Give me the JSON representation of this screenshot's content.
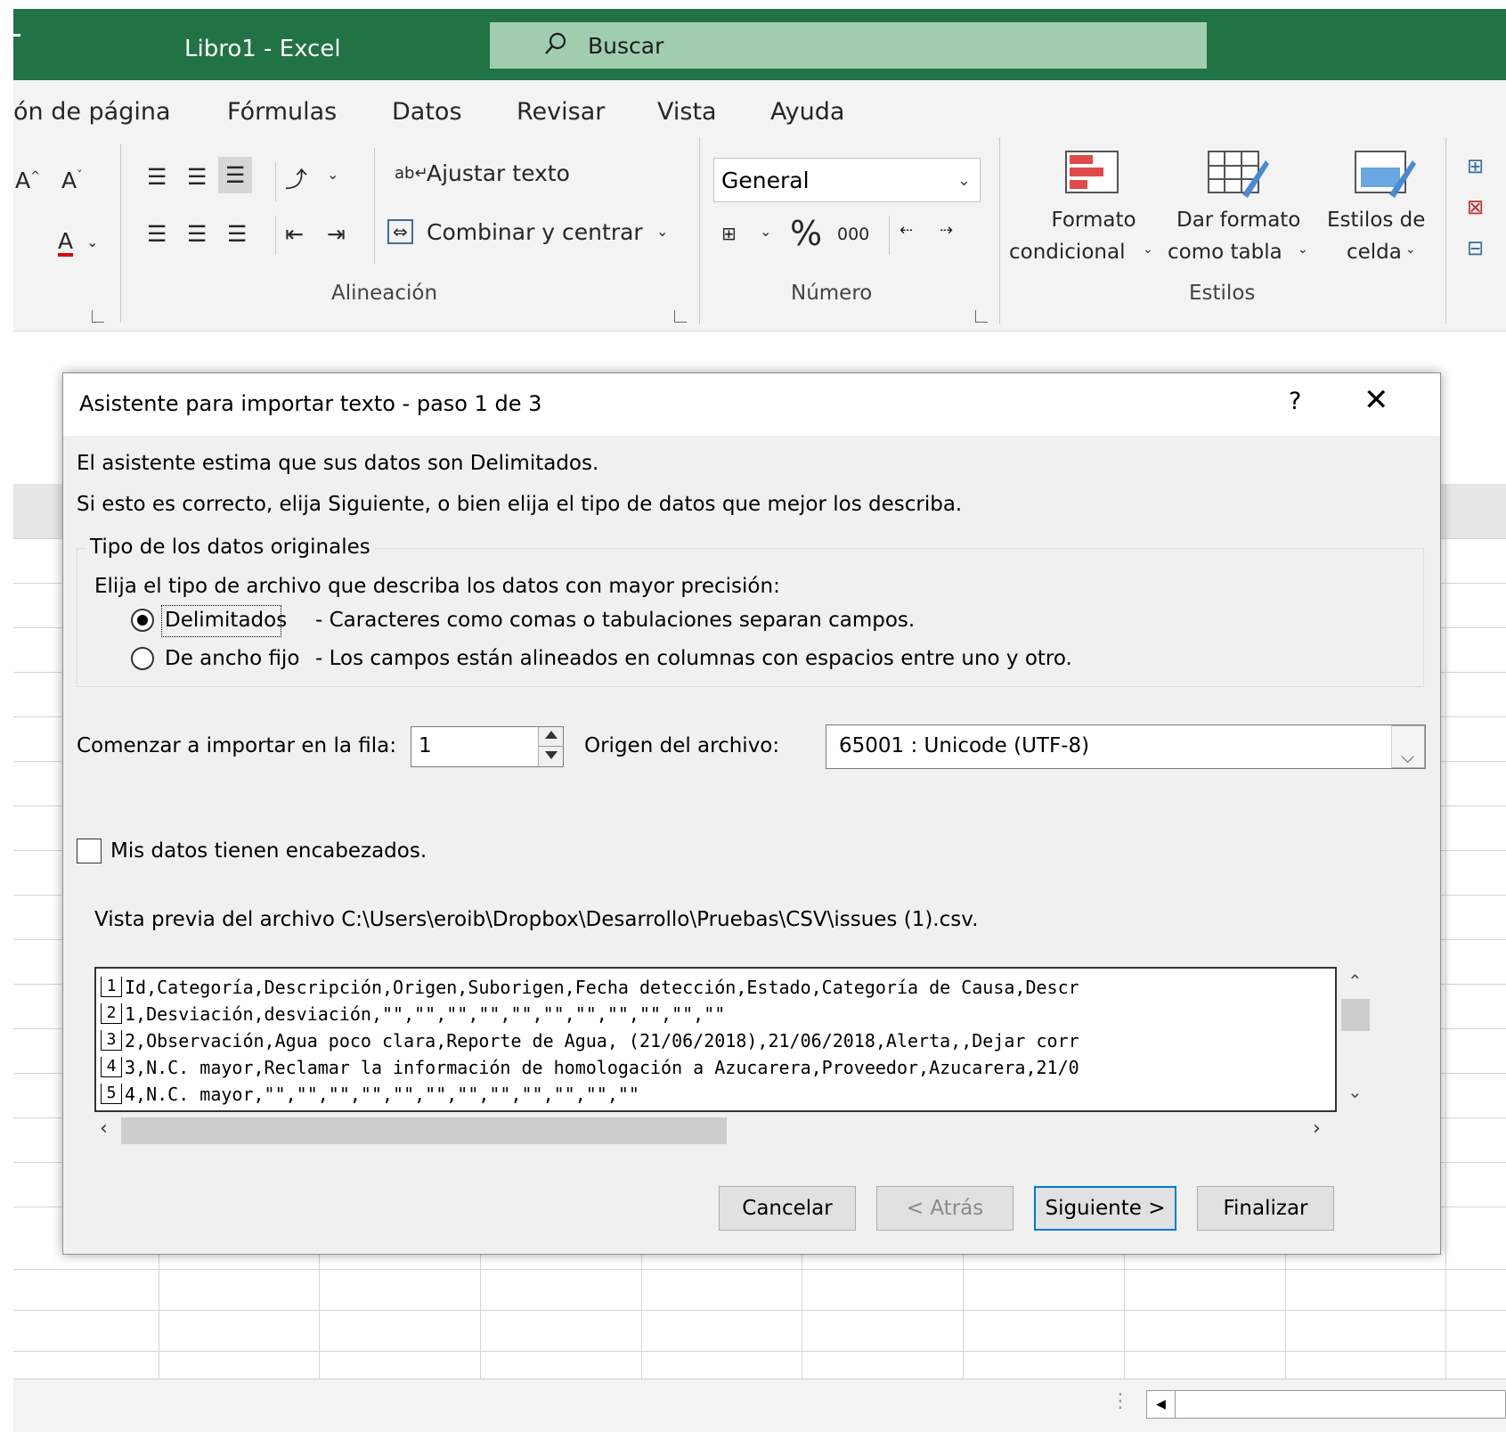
{
  "window": {
    "title": "Libro1  -  Excel",
    "search_placeholder": "Buscar"
  },
  "ribbon": {
    "tabs": [
      "ón de página",
      "Fórmulas",
      "Datos",
      "Revisar",
      "Vista",
      "Ayuda"
    ],
    "alignment": {
      "wrap_text": "Ajustar texto",
      "merge_center": "Combinar y centrar",
      "group_label": "Alineación"
    },
    "number": {
      "format_value": "General",
      "percent": "%",
      "thousands": "000",
      "group_label": "Número"
    },
    "styles": {
      "conditional_format_line1": "Formato",
      "conditional_format_line2": "condicional",
      "format_table_line1": "Dar formato",
      "format_table_line2": "como tabla",
      "cell_styles_line1": "Estilos de",
      "cell_styles_line2": "celda",
      "group_label": "Estilos"
    }
  },
  "dialog": {
    "title": "Asistente para importar texto - paso 1 de 3",
    "help": "?",
    "close": "✕",
    "intro_line1": "El asistente estima que sus datos son Delimitados.",
    "intro_line2": "Si esto es correcto, elija Siguiente, o bien elija el tipo de datos que mejor los describa.",
    "group_title": "Tipo de los datos originales",
    "group_prompt": "Elija el tipo de archivo que describa los datos con mayor precisión:",
    "options": [
      {
        "label": "Delimitados",
        "description": "- Caracteres como comas o tabulaciones separan campos.",
        "selected": true
      },
      {
        "label": "De ancho fijo",
        "description": "- Los campos están alineados en columnas con espacios entre uno y otro.",
        "selected": false
      }
    ],
    "start_row_label": "Comenzar a importar en la fila:",
    "start_row_value": "1",
    "origin_label": "Origen del archivo:",
    "origin_value": "65001 : Unicode (UTF-8)",
    "headers_checkbox_label": "Mis datos tienen encabezados.",
    "headers_checked": false,
    "preview_label": "Vista previa del archivo C:\\Users\\eroib\\Dropbox\\Desarrollo\\Pruebas\\CSV\\issues (1).csv.",
    "preview_rows": [
      {
        "n": "1",
        "text": "Id,Categoría,Descripción,Origen,Suborigen,Fecha detección,Estado,Categoría de Causa,Descr"
      },
      {
        "n": "2",
        "text": "1,Desviación,desviación,\"\",\"\",\"\",\"\",\"\",\"\",\"\",\"\",\"\",\"\",\"\""
      },
      {
        "n": "3",
        "text": "2,Observación,Agua poco clara,Reporte de Agua, (21/06/2018),21/06/2018,Alerta,,Dejar corr"
      },
      {
        "n": "4",
        "text": "3,N.C. mayor,Reclamar la información de homologación a Azucarera,Proveedor,Azucarera,21/0"
      },
      {
        "n": "5",
        "text": "4,N.C. mayor,\"\",\"\",\"\",\"\",\"\",\"\",\"\",\"\",\"\",\"\",\"\",\"\""
      }
    ],
    "buttons": {
      "cancel": "Cancelar",
      "back": "< Atrás",
      "next": "Siguiente >",
      "finish": "Finalizar"
    }
  },
  "colors": {
    "excel_green": "#217346",
    "search_bg": "#a0cdb0",
    "ribbon_bg": "#f3f3f3",
    "dialog_bg": "#f0f0f0",
    "focus_blue": "#0078d7"
  }
}
